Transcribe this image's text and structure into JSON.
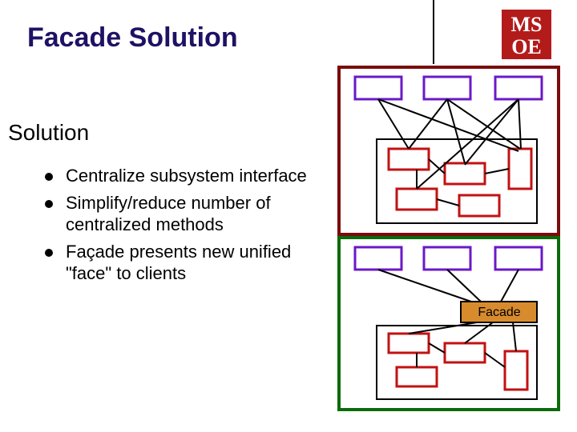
{
  "title": "Facade Solution",
  "subtitle": "Solution",
  "bullets": [
    "Centralize subsystem interface",
    "Simplify/reduce number of centralized methods",
    "Façade presents new unified \"face\" to clients"
  ],
  "logo": {
    "line1": "MS",
    "line2": "OE"
  },
  "facade_label": "Facade",
  "diagram": {
    "description": "Two stacked diagrams. Top (red border): three client boxes connect directly to many subsystem boxes inside a container — tangled dependencies. Bottom (green border): three client boxes all connect to a single Facade box which then connects to the subsystem boxes — simplified dependencies.",
    "top_panel": {
      "border_color": "#7a0c0c",
      "clients": 3,
      "subsystem_boxes": 5,
      "connections": "many-to-many"
    },
    "bottom_panel": {
      "border_color": "#0b6b0b",
      "clients": 3,
      "facade": true,
      "subsystem_boxes": 4,
      "connections": "clients → facade → subsystem"
    }
  }
}
